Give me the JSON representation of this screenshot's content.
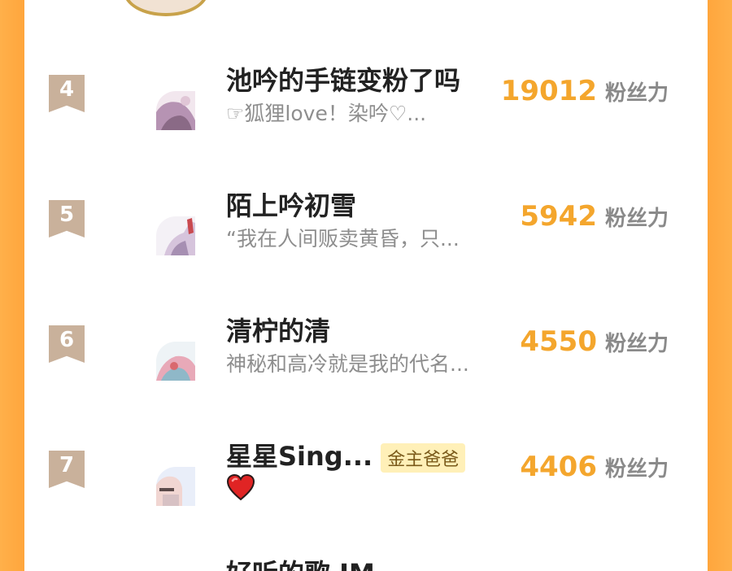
{
  "rows": [
    {
      "rank": "4",
      "name": "池吟的手链变粉了吗",
      "subtitle": "☞狐狸love！染吟♡...",
      "score": "19012",
      "unit": "粉丝力"
    },
    {
      "rank": "5",
      "name": "陌上吟初雪",
      "subtitle": "“我在人间贩卖黄昏，只...",
      "score": "5942",
      "unit": "粉丝力"
    },
    {
      "rank": "6",
      "name": "清柠的清",
      "subtitle": "神秘和高冷就是我的代名...",
      "score": "4550",
      "unit": "粉丝力"
    },
    {
      "rank": "7",
      "name": "星星Sing...",
      "badge": "金主爸爸",
      "score": "4406",
      "unit": "粉丝力",
      "icon": "heart-icon"
    }
  ],
  "partial_next_name": "好听的歌 JM",
  "colors": {
    "accent": "#f4a62d",
    "rank_bg": "#c9b19b",
    "background": "#ffa43a",
    "badge_bg": "#fff0b8"
  }
}
